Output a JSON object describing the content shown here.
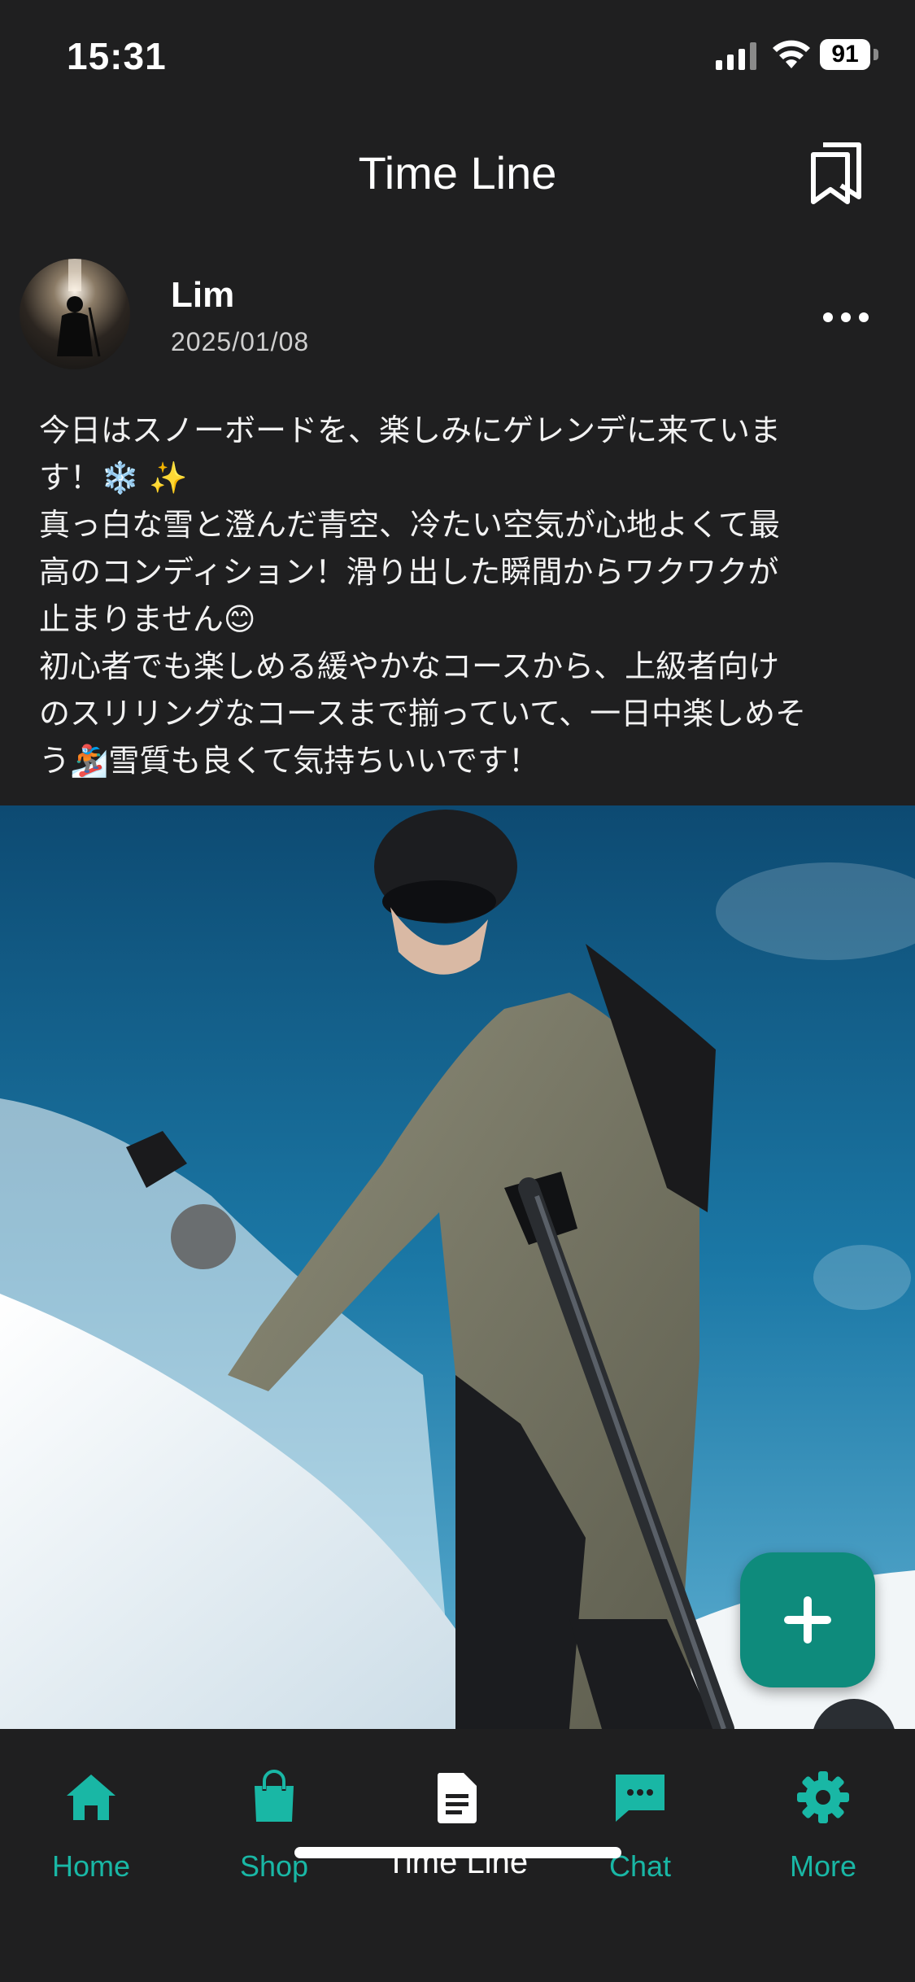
{
  "status_bar": {
    "time": "15:31",
    "battery": "91"
  },
  "header": {
    "title": "Time Line"
  },
  "post": {
    "username": "Lim",
    "date": "2025/01/08",
    "lines": [
      "今日はスノーボードを、楽しみにゲレンデに来ていま",
      "す！❄️ ✨",
      "真っ白な雪と澄んだ青空、冷たい空気が心地よくて最",
      "高のコンディション！滑り出した瞬間からワクワクが",
      "止まりません😊",
      "初心者でも楽しめる緩やかなコースから、上級者向け",
      "のスリリングなコースまで揃っていて、一日中楽しめそ",
      "う🏂雪質も良くて気持ちいいです！"
    ]
  },
  "nav": {
    "items": [
      {
        "label": "Home",
        "icon": "home-icon"
      },
      {
        "label": "Shop",
        "icon": "shopping-bag-icon"
      },
      {
        "label": "Time Line",
        "icon": "document-icon"
      },
      {
        "label": "Chat",
        "icon": "chat-icon"
      },
      {
        "label": "More",
        "icon": "gear-icon"
      }
    ]
  },
  "colors": {
    "accent": "#19b7a5",
    "fab": "#0e8b7c",
    "background": "#1f1f20"
  }
}
